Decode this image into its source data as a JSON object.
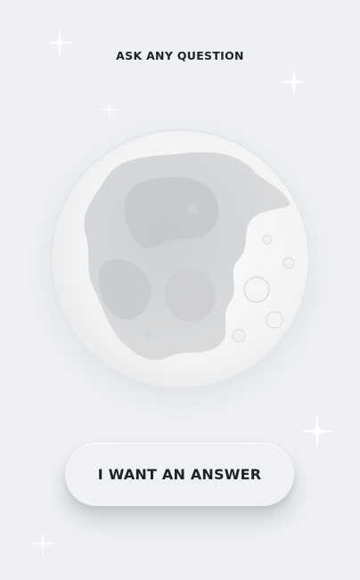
{
  "header": {
    "prompt_text": "ASK ANY QUESTION"
  },
  "moon": {
    "icon": "moon-illustration"
  },
  "action": {
    "button_label": "I WANT AN ANSWER"
  },
  "decorations": {
    "icon": "sparkle-icon",
    "count": 5
  },
  "colors": {
    "background": "#eef0f3",
    "text": "#1d2326",
    "button_surface": "#f0f1f4",
    "moon_light": "#f6f7f8",
    "moon_shadow": "#c9cccf"
  }
}
